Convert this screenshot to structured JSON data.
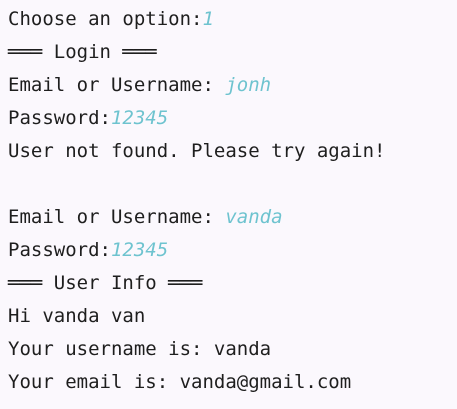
{
  "console": {
    "menu_prompt": "Choose an option:",
    "menu_input": "1",
    "login_header": "═══ Login ═══",
    "attempt1": {
      "user_label": "Email or Username: ",
      "user_input": "jonh",
      "pass_label": "Password:",
      "pass_input": "12345"
    },
    "error_message": "User not found. Please try again!",
    "attempt2": {
      "user_label": "Email or Username: ",
      "user_input": "vanda",
      "pass_label": "Password:",
      "pass_input": "12345"
    },
    "info_header": "═══ User Info ═══",
    "greeting": "Hi vanda van",
    "username_line": "Your username is: vanda",
    "email_line": "Your email is: vanda@gmail.com"
  }
}
